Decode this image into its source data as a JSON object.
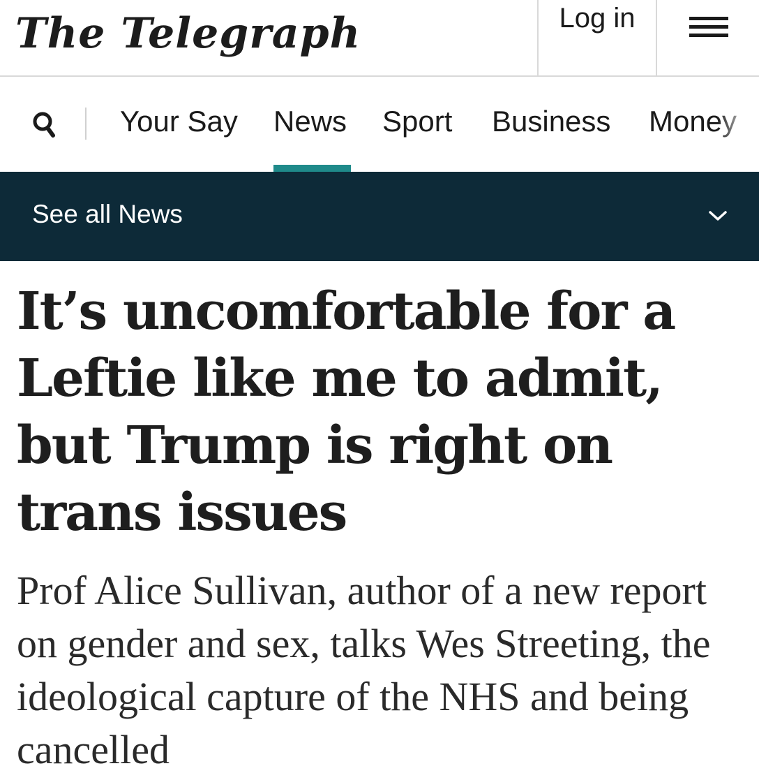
{
  "header": {
    "logo_text": "The Telegraph",
    "login_label": "Log in",
    "menu_icon": "hamburger-menu-icon"
  },
  "nav": {
    "search_icon": "search-icon",
    "items": [
      {
        "label": "Your Say"
      },
      {
        "label": "News",
        "active": true
      },
      {
        "label": "Sport"
      },
      {
        "label": "Business"
      },
      {
        "label": "Money"
      }
    ],
    "accent_color": "#1f8a8a"
  },
  "section_bar": {
    "label": "See all News",
    "chevron_icon": "chevron-down-icon",
    "background_color": "#0d2a38"
  },
  "article": {
    "headline": "It’s uncomfortable for a Leftie like me to admit, but Trump is right on trans issues",
    "standfirst": "Prof Alice Sullivan, author of a new report on gender and sex, talks Wes Streeting, the ideological capture of the NHS and being cancelled"
  }
}
